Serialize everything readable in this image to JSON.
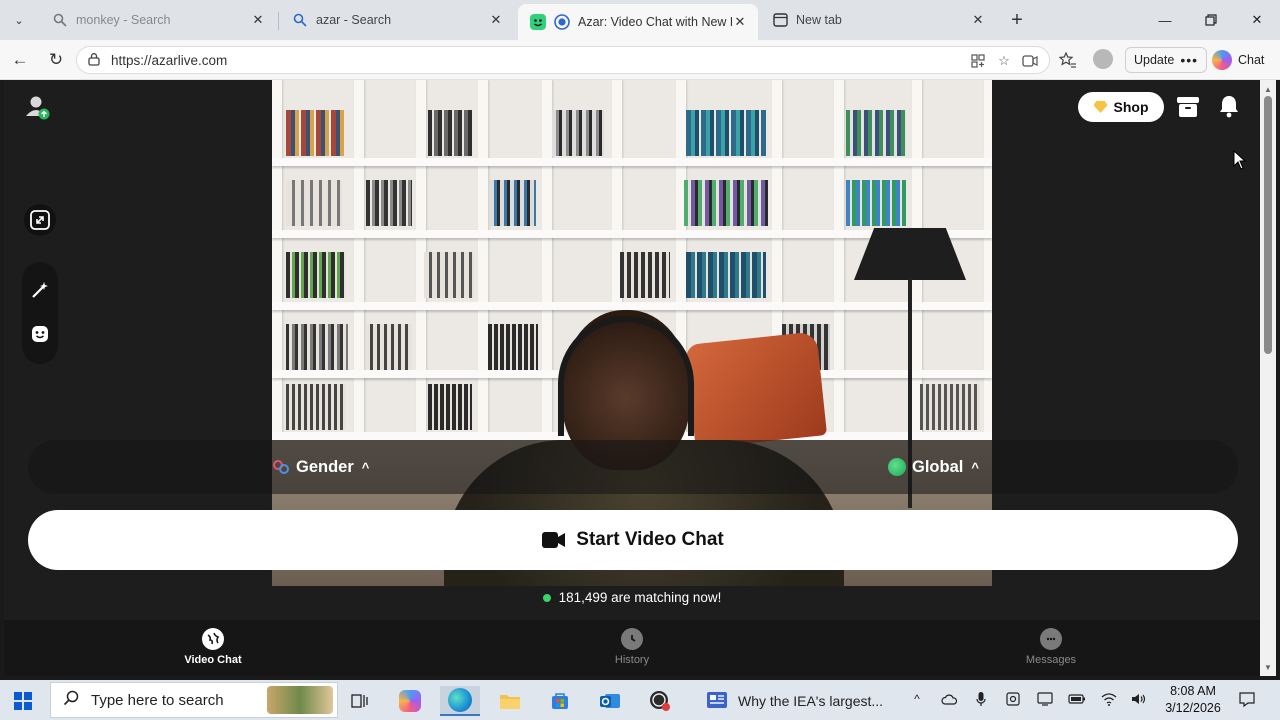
{
  "browser": {
    "tabs": [
      {
        "title": "monkey - Search",
        "active": false
      },
      {
        "title": "azar - Search",
        "active": false
      },
      {
        "title": "Azar: Video Chat with New Pe",
        "active": true
      },
      {
        "title": "New tab",
        "active": false
      }
    ],
    "url": "https://azarlive.com",
    "update_label": "Update",
    "chat_label": "Chat"
  },
  "page": {
    "shop_label": "Shop",
    "filters": {
      "gender_label": "Gender",
      "region_label": "Global"
    },
    "start_button_label": "Start Video Chat",
    "matching_text": "181,499 are matching now!",
    "bottom_nav": [
      {
        "label": "Video Chat",
        "icon": "globe-icon",
        "active": true
      },
      {
        "label": "History",
        "icon": "clock-icon",
        "active": false
      },
      {
        "label": "Messages",
        "icon": "chat-bubble-icon",
        "active": false
      }
    ],
    "colors": {
      "accent_green": "#38d46a",
      "background": "#1d1d1d",
      "button_bg": "#ffffff"
    }
  },
  "taskbar": {
    "search_placeholder": "Type here to search",
    "news_text": "Why the IEA's largest...",
    "time": "8:08 AM",
    "date": "3/12/2026"
  }
}
